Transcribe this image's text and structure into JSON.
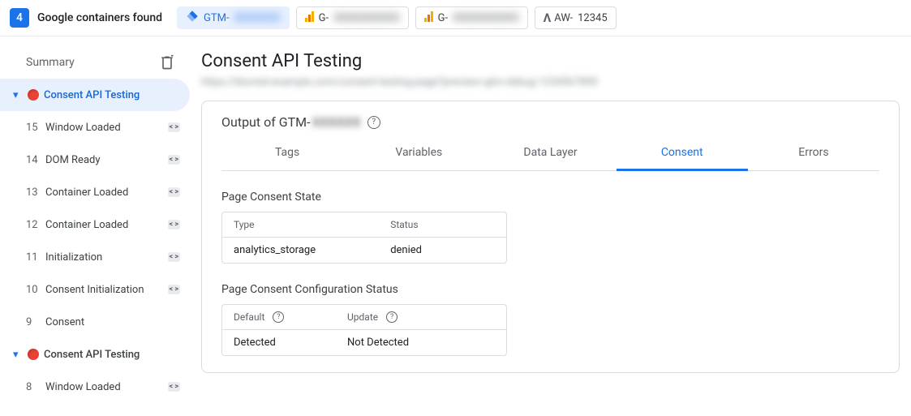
{
  "topbar": {
    "count": "4",
    "label": "Google containers found",
    "containers": [
      {
        "kind": "gtm",
        "prefix": "GTM-",
        "tail": "XXXXXXX",
        "active": true
      },
      {
        "kind": "ga",
        "prefix": "G-",
        "tail": "XXXXXXXXXX",
        "active": false
      },
      {
        "kind": "ga",
        "prefix": "G-",
        "tail": "XXXXXXXXXX",
        "active": false
      },
      {
        "kind": "aw",
        "prefix": "AW-",
        "tail": "12345",
        "active": false
      }
    ]
  },
  "sidebar": {
    "summary": "Summary",
    "items": [
      {
        "type": "section",
        "label": "Consent API Testing",
        "active": true
      },
      {
        "type": "event",
        "num": "15",
        "label": "Window Loaded",
        "chip": true
      },
      {
        "type": "event",
        "num": "14",
        "label": "DOM Ready",
        "chip": true
      },
      {
        "type": "event",
        "num": "13",
        "label": "Container Loaded",
        "chip": true
      },
      {
        "type": "event",
        "num": "12",
        "label": "Container Loaded",
        "chip": true
      },
      {
        "type": "event",
        "num": "11",
        "label": "Initialization",
        "chip": true
      },
      {
        "type": "event",
        "num": "10",
        "label": "Consent Initialization",
        "chip": true
      },
      {
        "type": "event",
        "num": "9",
        "label": "Consent",
        "chip": false
      },
      {
        "type": "section",
        "label": "Consent API Testing",
        "active": false
      },
      {
        "type": "event",
        "num": "8",
        "label": "Window Loaded",
        "chip": true
      }
    ]
  },
  "main": {
    "title": "Consent API Testing",
    "subline": "https://blurred-example.com/consent-testing-page?preview=gtm-debug-1234567890",
    "output_prefix": "Output of GTM-",
    "output_blur": "XXXXXX",
    "tabs": [
      "Tags",
      "Variables",
      "Data Layer",
      "Consent",
      "Errors"
    ],
    "active_tab": 3,
    "pcs_heading": "Page Consent State",
    "pcs_headers": {
      "type": "Type",
      "status": "Status"
    },
    "pcs_row": {
      "type": "analytics_storage",
      "status": "denied"
    },
    "cfg_heading": "Page Consent Configuration Status",
    "cfg_headers": {
      "default": "Default",
      "update": "Update"
    },
    "cfg_row": {
      "default": "Detected",
      "update": "Not Detected"
    },
    "chip_glyph": "< >"
  }
}
